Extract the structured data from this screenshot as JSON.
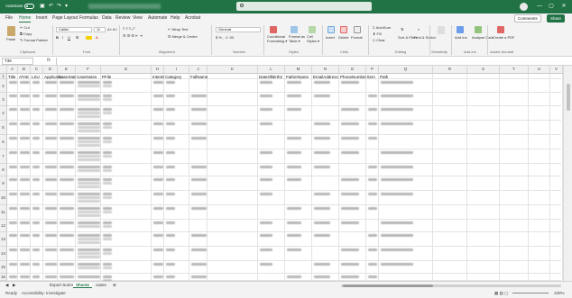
{
  "titlebar": {
    "autosave_label": "AutoSave",
    "toggle_state": "Off",
    "minimize": "—",
    "maximize": "▢",
    "close": "✕"
  },
  "ribbon_tabs": [
    "File",
    "Home",
    "Insert",
    "Page Layout",
    "Formulas",
    "Data",
    "Review",
    "View",
    "Automate",
    "Help",
    "Acrobat"
  ],
  "active_tab": "Home",
  "ribbon_buttons": {
    "comments": "Comments",
    "share": "Share"
  },
  "ribbon": {
    "clipboard": {
      "paste": "Paste",
      "cut": "Cut",
      "copy": "Copy",
      "format_painter": "Format Painter",
      "label": "Clipboard"
    },
    "font": {
      "name": "Calibri",
      "size": "11",
      "label": "Font"
    },
    "alignment": {
      "wrap": "Wrap Text",
      "merge": "Merge & Centre",
      "label": "Alignment"
    },
    "number": {
      "format": "General",
      "label": "Number"
    },
    "styles": {
      "conditional": "Conditional Formatting",
      "format_table": "Format as Table",
      "cell_styles": "Cell Styles",
      "label": "Styles"
    },
    "cells": {
      "insert": "Insert",
      "delete": "Delete",
      "format": "Format",
      "label": "Cells"
    },
    "editing": {
      "autosum": "AutoSum",
      "fill": "Fill",
      "clear": "Clear",
      "sort": "Sort & Filter",
      "find": "Find & Select",
      "label": "Editing"
    },
    "sensitivity": {
      "label": "Sensitivity"
    },
    "addins": {
      "addins": "Add-ins",
      "analyse": "Analyse Data",
      "label": "Add-ins"
    },
    "acrobat": {
      "create_pdf": "Create a PDF",
      "label": "Adobe Acrobat"
    }
  },
  "formula_bar": {
    "name_box": "T36",
    "fx": "fx"
  },
  "columns": [
    "A",
    "B",
    "C",
    "D",
    "E",
    "F",
    "G",
    "H",
    "I",
    "J",
    "K",
    "L",
    "M",
    "N",
    "O",
    "P",
    "Q",
    "R",
    "S",
    "T",
    "U",
    "V"
  ],
  "headers": [
    "Title",
    "ATAE",
    "LSU",
    "ApplicationDate",
    "CaseStatus",
    "CaseNotes",
    "PFile",
    "IntentCase",
    "Category",
    "FullName",
    "DateOfBirth2",
    "FatherName",
    "EmailAddress",
    "PhoneNumber",
    "Item",
    "Path"
  ],
  "rows": [
    "1",
    "2",
    "3",
    "4",
    "5",
    "6",
    "7",
    "8",
    "9",
    "10",
    "11",
    "12",
    "13",
    "14",
    "15",
    "16"
  ],
  "sheet_tabs": [
    "Export Summary",
    "Sheet4",
    "cases"
  ],
  "active_sheet": "Sheet4",
  "status": {
    "ready": "Ready",
    "accessibility": "Accessibility: Investigate",
    "zoom": "100%"
  },
  "colors": {
    "excel_green": "#217346"
  }
}
